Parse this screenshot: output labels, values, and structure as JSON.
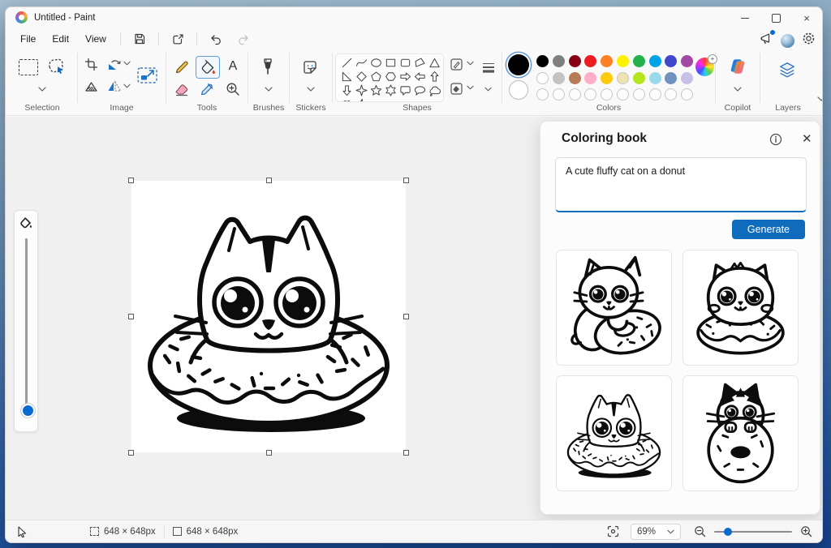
{
  "window": {
    "title": "Untitled - Paint"
  },
  "menu": {
    "items": [
      "File",
      "Edit",
      "View"
    ]
  },
  "ribbon": {
    "labels": {
      "selection": "Selection",
      "image": "Image",
      "tools": "Tools",
      "brushes": "Brushes",
      "stickers": "Stickers",
      "shapes": "Shapes",
      "colors": "Colors",
      "copilot": "Copilot",
      "layers": "Layers"
    },
    "tools": {
      "text_tool_label": "A"
    },
    "palette": {
      "selected_color": "#000000",
      "secondary_color": "#ffffff",
      "row1": [
        "#000000",
        "#7f7f7f",
        "#880015",
        "#ed1c24",
        "#ff7f27",
        "#fff200",
        "#22b14c",
        "#00a2e8",
        "#3f48cc",
        "#a349a4"
      ],
      "row2": [
        "#ffffff",
        "#c3c3c3",
        "#b97a57",
        "#ffaec9",
        "#ffc90e",
        "#efe4b0",
        "#b5e61d",
        "#99d9ea",
        "#7092be",
        "#c8bfe7"
      ],
      "empty_slots": 10
    },
    "shape_names": [
      "line",
      "curve",
      "oval",
      "rectangle",
      "rounded-rectangle",
      "polygon",
      "triangle",
      "right-triangle",
      "diamond",
      "pentagon",
      "hexagon",
      "arrow-right",
      "arrow-left",
      "arrow-up",
      "arrow-down",
      "four-point-star",
      "five-point-star",
      "six-point-star",
      "speech-bubble",
      "oval-speech-bubble",
      "thought-bubble",
      "heart",
      "lightning"
    ]
  },
  "panel": {
    "title": "Coloring book",
    "prompt_value": "A cute fluffy cat on a donut",
    "generate_label": "Generate",
    "thumbnails": [
      "Cat hugging a donut",
      "Fluffy cat on a donut",
      "Cat sitting in a donut",
      "Black and white cat behind a donut"
    ]
  },
  "statusbar": {
    "selection_size": "648 × 648px",
    "canvas_size": "648 × 648px",
    "zoom_level": "69%"
  },
  "colors": {
    "accent": "#0f6cbd"
  }
}
